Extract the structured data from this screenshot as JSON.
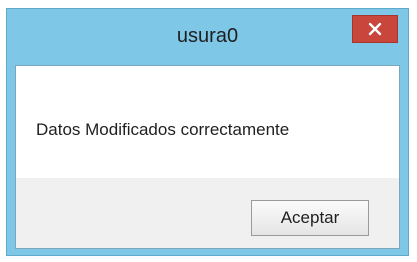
{
  "window": {
    "title": "usura0",
    "close_icon": "close-icon"
  },
  "dialog": {
    "message": "Datos Modificados correctamente",
    "ok_label": "Aceptar"
  },
  "colors": {
    "frame": "#7fc7e6",
    "close_button": "#c9463d",
    "footer": "#f0f0f0"
  }
}
